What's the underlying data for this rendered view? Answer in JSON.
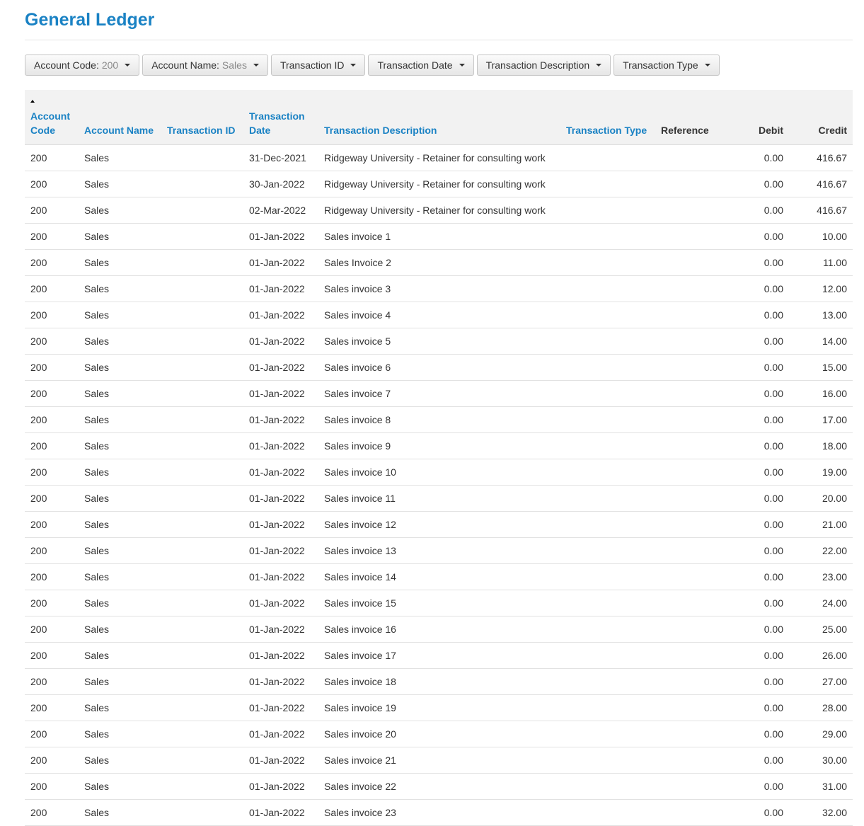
{
  "page": {
    "title": "General Ledger"
  },
  "filters": [
    {
      "label": "Account Code:",
      "value": "200"
    },
    {
      "label": "Account Name:",
      "value": "Sales"
    },
    {
      "label": "Transaction ID",
      "value": ""
    },
    {
      "label": "Transaction Date",
      "value": ""
    },
    {
      "label": "Transaction Description",
      "value": ""
    },
    {
      "label": "Transaction Type",
      "value": ""
    }
  ],
  "table": {
    "sorted_column": "account_code",
    "sort_direction": "ascending",
    "columns": [
      {
        "key": "account_code",
        "label_line1": "Account",
        "label_line2": "Code",
        "sortable": true
      },
      {
        "key": "account_name",
        "label_line1": "",
        "label_line2": "Account Name",
        "sortable": true
      },
      {
        "key": "transaction_id",
        "label_line1": "",
        "label_line2": "Transaction ID",
        "sortable": true
      },
      {
        "key": "transaction_date",
        "label_line1": "Transaction",
        "label_line2": "Date",
        "sortable": true
      },
      {
        "key": "transaction_description",
        "label_line1": "",
        "label_line2": "Transaction Description",
        "sortable": true
      },
      {
        "key": "transaction_type",
        "label_line1": "",
        "label_line2": "Transaction Type",
        "sortable": true
      },
      {
        "key": "reference",
        "label_line1": "",
        "label_line2": "Reference",
        "sortable": false
      },
      {
        "key": "debit",
        "label_line1": "",
        "label_line2": "Debit",
        "sortable": false
      },
      {
        "key": "credit",
        "label_line1": "",
        "label_line2": "Credit",
        "sortable": false
      }
    ],
    "rows": [
      [
        "200",
        "Sales",
        "",
        "31-Dec-2021",
        "Ridgeway University - Retainer for consulting work",
        "",
        "",
        "0.00",
        "416.67"
      ],
      [
        "200",
        "Sales",
        "",
        "30-Jan-2022",
        "Ridgeway University - Retainer for consulting work",
        "",
        "",
        "0.00",
        "416.67"
      ],
      [
        "200",
        "Sales",
        "",
        "02-Mar-2022",
        "Ridgeway University - Retainer for consulting work",
        "",
        "",
        "0.00",
        "416.67"
      ],
      [
        "200",
        "Sales",
        "",
        "01-Jan-2022",
        "Sales invoice 1",
        "",
        "",
        "0.00",
        "10.00"
      ],
      [
        "200",
        "Sales",
        "",
        "01-Jan-2022",
        "Sales Invoice 2",
        "",
        "",
        "0.00",
        "11.00"
      ],
      [
        "200",
        "Sales",
        "",
        "01-Jan-2022",
        "Sales invoice 3",
        "",
        "",
        "0.00",
        "12.00"
      ],
      [
        "200",
        "Sales",
        "",
        "01-Jan-2022",
        "Sales invoice 4",
        "",
        "",
        "0.00",
        "13.00"
      ],
      [
        "200",
        "Sales",
        "",
        "01-Jan-2022",
        "Sales invoice 5",
        "",
        "",
        "0.00",
        "14.00"
      ],
      [
        "200",
        "Sales",
        "",
        "01-Jan-2022",
        "Sales invoice 6",
        "",
        "",
        "0.00",
        "15.00"
      ],
      [
        "200",
        "Sales",
        "",
        "01-Jan-2022",
        "Sales invoice 7",
        "",
        "",
        "0.00",
        "16.00"
      ],
      [
        "200",
        "Sales",
        "",
        "01-Jan-2022",
        "Sales invoice 8",
        "",
        "",
        "0.00",
        "17.00"
      ],
      [
        "200",
        "Sales",
        "",
        "01-Jan-2022",
        "Sales invoice 9",
        "",
        "",
        "0.00",
        "18.00"
      ],
      [
        "200",
        "Sales",
        "",
        "01-Jan-2022",
        "Sales invoice 10",
        "",
        "",
        "0.00",
        "19.00"
      ],
      [
        "200",
        "Sales",
        "",
        "01-Jan-2022",
        "Sales invoice 11",
        "",
        "",
        "0.00",
        "20.00"
      ],
      [
        "200",
        "Sales",
        "",
        "01-Jan-2022",
        "Sales invoice 12",
        "",
        "",
        "0.00",
        "21.00"
      ],
      [
        "200",
        "Sales",
        "",
        "01-Jan-2022",
        "Sales invoice 13",
        "",
        "",
        "0.00",
        "22.00"
      ],
      [
        "200",
        "Sales",
        "",
        "01-Jan-2022",
        "Sales invoice 14",
        "",
        "",
        "0.00",
        "23.00"
      ],
      [
        "200",
        "Sales",
        "",
        "01-Jan-2022",
        "Sales invoice 15",
        "",
        "",
        "0.00",
        "24.00"
      ],
      [
        "200",
        "Sales",
        "",
        "01-Jan-2022",
        "Sales invoice 16",
        "",
        "",
        "0.00",
        "25.00"
      ],
      [
        "200",
        "Sales",
        "",
        "01-Jan-2022",
        "Sales invoice 17",
        "",
        "",
        "0.00",
        "26.00"
      ],
      [
        "200",
        "Sales",
        "",
        "01-Jan-2022",
        "Sales invoice 18",
        "",
        "",
        "0.00",
        "27.00"
      ],
      [
        "200",
        "Sales",
        "",
        "01-Jan-2022",
        "Sales invoice 19",
        "",
        "",
        "0.00",
        "28.00"
      ],
      [
        "200",
        "Sales",
        "",
        "01-Jan-2022",
        "Sales invoice 20",
        "",
        "",
        "0.00",
        "29.00"
      ],
      [
        "200",
        "Sales",
        "",
        "01-Jan-2022",
        "Sales invoice 21",
        "",
        "",
        "0.00",
        "30.00"
      ],
      [
        "200",
        "Sales",
        "",
        "01-Jan-2022",
        "Sales invoice 22",
        "",
        "",
        "0.00",
        "31.00"
      ],
      [
        "200",
        "Sales",
        "",
        "01-Jan-2022",
        "Sales invoice 23",
        "",
        "",
        "0.00",
        "32.00"
      ]
    ]
  }
}
